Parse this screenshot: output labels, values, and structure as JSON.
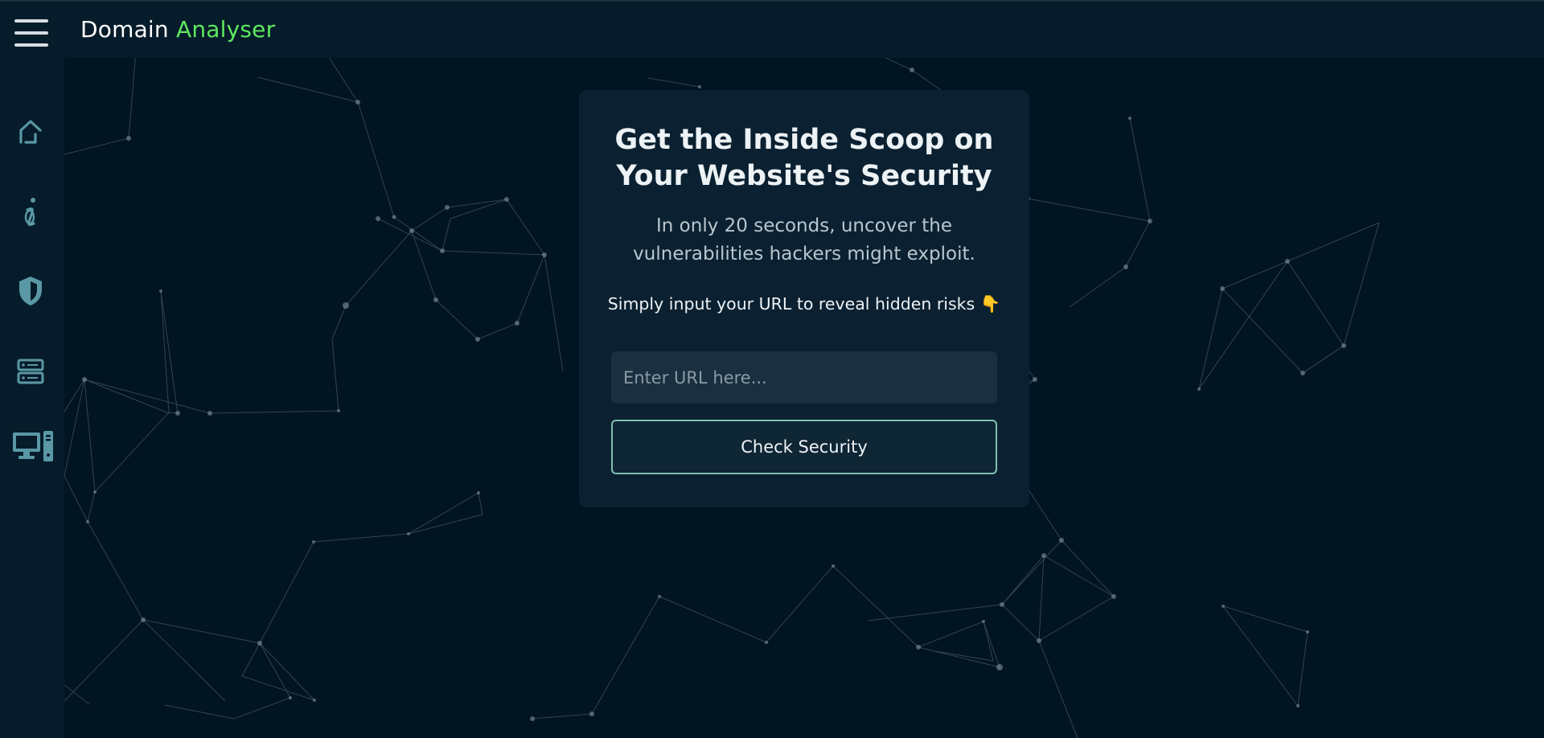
{
  "header": {
    "brand_main": "Domain",
    "brand_accent": "Analyser",
    "accent_color": "#5ee860"
  },
  "sidebar": {
    "items": [
      {
        "icon": "home-icon"
      },
      {
        "icon": "info-icon"
      },
      {
        "icon": "shield-icon"
      },
      {
        "icon": "server-icon"
      },
      {
        "icon": "desktop-computer-icon"
      }
    ],
    "icon_color": "#5a98a5"
  },
  "hero": {
    "title": "Get the Inside Scoop on Your Website's Security",
    "subtitle": "In only 20 seconds, uncover the vulnerabilities hackers might exploit.",
    "prompt": "Simply input your URL to reveal hidden risks 👇",
    "input_placeholder": "Enter URL here...",
    "input_value": "",
    "button_label": "Check Security"
  },
  "colors": {
    "background": "#011421",
    "panel": "#061c2a",
    "card": "#0b2131",
    "button_border": "#7fbfb0"
  }
}
